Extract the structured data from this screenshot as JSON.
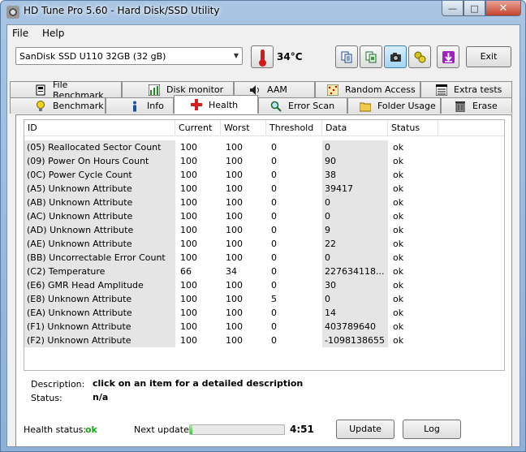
{
  "window": {
    "title": "HD Tune Pro 5.60 - Hard Disk/SSD Utility"
  },
  "window_controls": {
    "minimize": "—",
    "maximize": "□",
    "close": "✕"
  },
  "menu": [
    {
      "label": "File",
      "icon": ""
    },
    {
      "label": "Help",
      "icon": ""
    }
  ],
  "toolbar": {
    "drive": "SanDisk SSD U110 32GB (32 gB)",
    "temperature": "34°C",
    "exit_label": "Exit",
    "buttons": [
      {
        "icon": "copy-text-icon"
      },
      {
        "icon": "copy-screen-icon"
      },
      {
        "icon": "camera-icon"
      },
      {
        "icon": "options-icon"
      },
      {
        "icon": "save-icon"
      }
    ]
  },
  "tabs": {
    "row1": [
      {
        "label": "File Benchmark",
        "icon": "file-benchmark-icon"
      },
      {
        "label": "Disk monitor",
        "icon": "disk-monitor-icon"
      },
      {
        "label": "AAM",
        "icon": "speaker-icon"
      },
      {
        "label": "Random Access",
        "icon": "random-access-icon"
      },
      {
        "label": "Extra tests",
        "icon": "extra-tests-icon"
      }
    ],
    "row2": [
      {
        "label": "Benchmark",
        "icon": "bulb-icon"
      },
      {
        "label": "Info",
        "icon": "info-icon"
      },
      {
        "label": "Health",
        "icon": "health-cross-icon"
      },
      {
        "label": "Error Scan",
        "icon": "magnifier-icon"
      },
      {
        "label": "Folder Usage",
        "icon": "folder-icon"
      },
      {
        "label": "Erase",
        "icon": "trash-icon"
      }
    ],
    "selected": "Health"
  },
  "smart": {
    "columns": [
      "ID",
      "Current",
      "Worst",
      "Threshold",
      "Data",
      "Status"
    ],
    "rows": [
      [
        "(05) Reallocated Sector Count",
        "100",
        "100",
        "0",
        "0",
        "ok"
      ],
      [
        "(09) Power On Hours Count",
        "100",
        "100",
        "0",
        "90",
        "ok"
      ],
      [
        "(0C) Power Cycle Count",
        "100",
        "100",
        "0",
        "38",
        "ok"
      ],
      [
        "(A5) Unknown Attribute",
        "100",
        "100",
        "0",
        "39417",
        "ok"
      ],
      [
        "(AB) Unknown Attribute",
        "100",
        "100",
        "0",
        "0",
        "ok"
      ],
      [
        "(AC) Unknown Attribute",
        "100",
        "100",
        "0",
        "0",
        "ok"
      ],
      [
        "(AD) Unknown Attribute",
        "100",
        "100",
        "0",
        "9",
        "ok"
      ],
      [
        "(AE) Unknown Attribute",
        "100",
        "100",
        "0",
        "22",
        "ok"
      ],
      [
        "(BB) Uncorrectable Error Count",
        "100",
        "100",
        "0",
        "0",
        "ok"
      ],
      [
        "(C2) Temperature",
        "66",
        "34",
        "0",
        "227634118...",
        "ok"
      ],
      [
        "(E6) GMR Head Amplitude",
        "100",
        "100",
        "0",
        "30",
        "ok"
      ],
      [
        "(E8) Unknown Attribute",
        "100",
        "100",
        "5",
        "0",
        "ok"
      ],
      [
        "(EA) Unknown Attribute",
        "100",
        "100",
        "0",
        "14",
        "ok"
      ],
      [
        "(F1) Unknown Attribute",
        "100",
        "100",
        "0",
        "403789640",
        "ok"
      ],
      [
        "(F2) Unknown Attribute",
        "100",
        "100",
        "0",
        "-1098138655",
        "ok"
      ]
    ]
  },
  "description": {
    "label": "Description:",
    "value": "click on an item for a detailed description",
    "status_label": "Status:",
    "status_value": "n/a"
  },
  "footer": {
    "health_label": "Health status:",
    "health_value": "ok",
    "next_label": "Next update:",
    "progress": 0.03,
    "next_time": "4:51",
    "update_label": "Update",
    "log_label": "Log"
  },
  "colors": {
    "health_ok": "#1aa81a",
    "health_tab_cross": "#d81e1e",
    "progress": "#3cc03a"
  }
}
